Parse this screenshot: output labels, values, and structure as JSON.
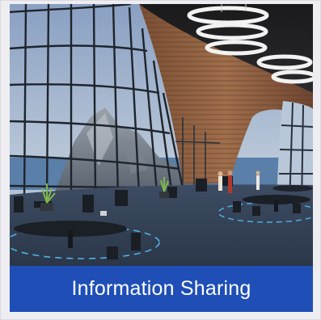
{
  "card": {
    "caption": "Information Sharing",
    "caption_bg": "#1f4fb6",
    "caption_color": "#ffffff"
  },
  "scene": {
    "image_subject": "virtual-world-lounge-render"
  }
}
